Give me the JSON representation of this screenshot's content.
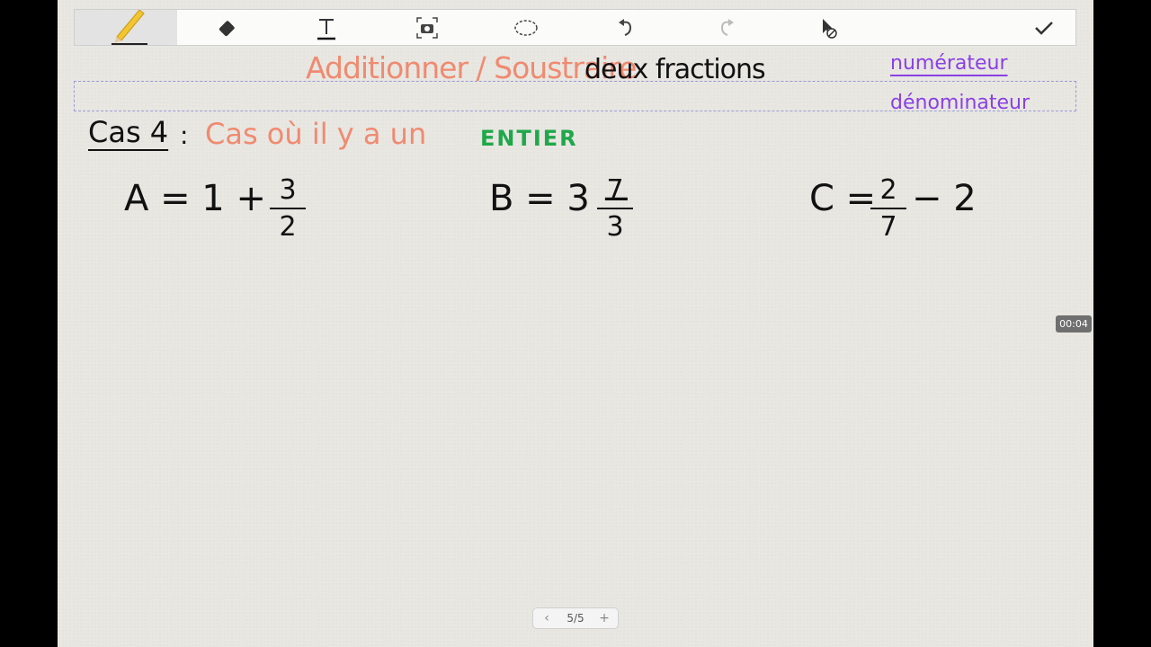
{
  "toolbar": {
    "tools": [
      "pencil",
      "eraser",
      "text",
      "camera",
      "lasso",
      "undo",
      "redo",
      "pointer",
      "done"
    ]
  },
  "note": {
    "title_colored": "Additionner / Soustraire",
    "title_plain": "deux fractions",
    "legend_top": "numérateur",
    "legend_bottom": "dénominateur",
    "case_label": "Cas 4",
    "colon": ":",
    "case_desc": "Cas où il y a un",
    "case_keyword": "ENTIER"
  },
  "exercises": {
    "a": {
      "left": "A = 1 +",
      "num": "3",
      "den": "2"
    },
    "b": {
      "left": "B = 3 −",
      "num": "7",
      "den": "3"
    },
    "c": {
      "left": "C =",
      "num": "2",
      "den": "7",
      "right": "− 2"
    }
  },
  "timer": "00:04",
  "pager": {
    "label": "5/5",
    "prev": "‹",
    "next": "+"
  },
  "colors": {
    "orange": "#f08a70",
    "purple": "#8a3fe6",
    "green": "#1fa84a",
    "record": "#f01818"
  }
}
